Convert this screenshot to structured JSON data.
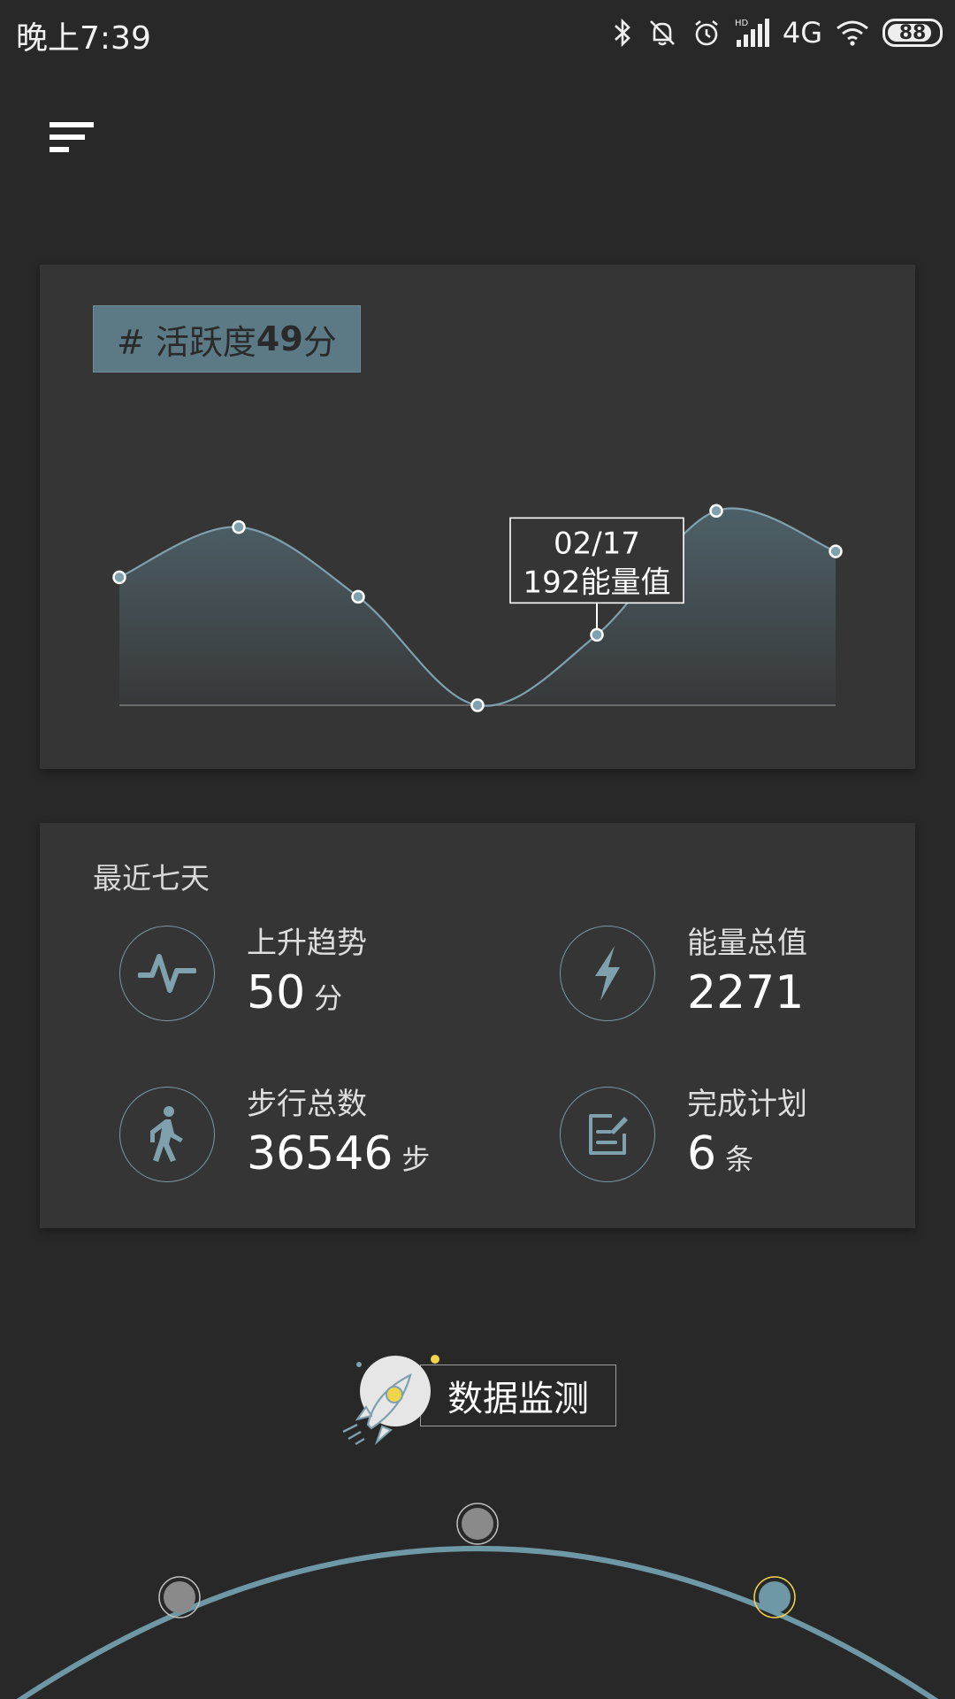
{
  "status": {
    "time": "晚上7:39",
    "network": "4G",
    "battery": "88",
    "battery_level": 0.88,
    "hd": "HD"
  },
  "chart_card": {
    "tag_prefix": "# 活跃度",
    "tag_value": "49",
    "tag_unit": "分",
    "tooltip": {
      "date": "02/17",
      "value_text": "192能量值"
    }
  },
  "chart_data": {
    "type": "area",
    "points": [
      {
        "index": 0,
        "value": 158
      },
      {
        "index": 1,
        "value": 220
      },
      {
        "index": 2,
        "value": 134
      },
      {
        "index": 3,
        "value": 0
      },
      {
        "index": 4,
        "value": 87
      },
      {
        "index": 5,
        "value": 240
      },
      {
        "index": 6,
        "value": 190
      }
    ],
    "highlight_index": 4,
    "ylim": [
      0,
      260
    ],
    "line_color": "#7fa1ad",
    "fill_color": "#5b7883"
  },
  "stats_card": {
    "title": "最近七天",
    "items": [
      {
        "label": "上升趋势",
        "value": "50",
        "unit": "分",
        "icon": "trend-icon"
      },
      {
        "label": "能量总值",
        "value": "2271",
        "unit": "",
        "icon": "lightning-icon"
      },
      {
        "label": "步行总数",
        "value": "36546",
        "unit": "步",
        "icon": "walking-icon"
      },
      {
        "label": "完成计划",
        "value": "6",
        "unit": "条",
        "icon": "plan-icon"
      }
    ]
  },
  "monitor": {
    "label": "数据监测",
    "icon": "rocket-icon"
  },
  "arc_nav": {
    "nodes": 3,
    "active_index": 2,
    "accent": "#6f98a6"
  }
}
